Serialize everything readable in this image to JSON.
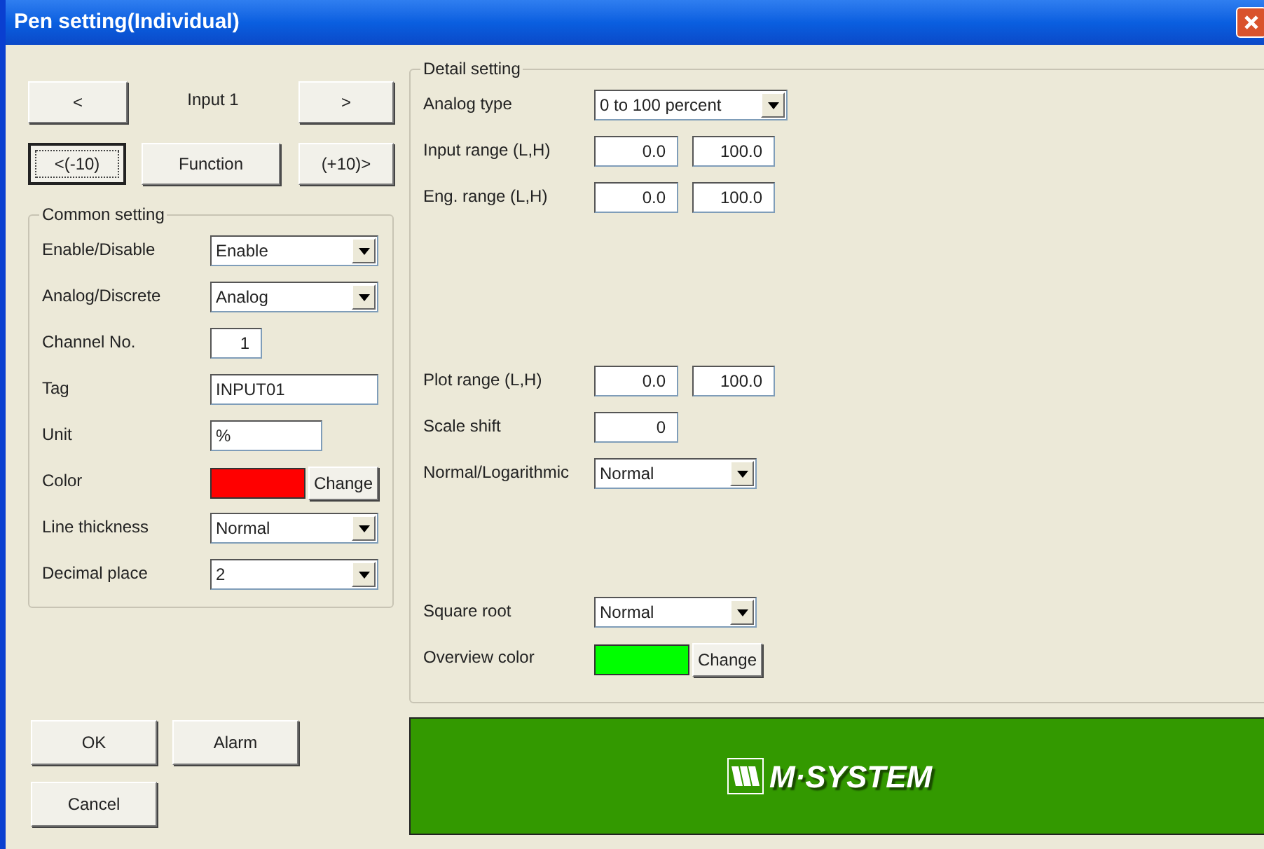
{
  "window": {
    "title": "Pen setting(Individual)"
  },
  "navigation": {
    "previous": "<",
    "channel_label": "Input 1",
    "next": ">",
    "back_ten": "<(-10)",
    "function": "Function",
    "forward_ten": "(+10)>"
  },
  "common_setting": {
    "title": "Common setting",
    "rows": [
      {
        "kind": "select",
        "label": "Enable/Disable",
        "value": "Enable"
      },
      {
        "kind": "select",
        "label": "Analog/Discrete",
        "value": "Analog"
      },
      {
        "kind": "number",
        "label": "Channel No.",
        "value": "1"
      },
      {
        "kind": "text",
        "label": "Tag",
        "value": "INPUT01"
      },
      {
        "kind": "short_text",
        "label": "Unit",
        "value": "%"
      },
      {
        "kind": "color",
        "label": "Color",
        "color": "#ff0000",
        "button": "Change"
      },
      {
        "kind": "select",
        "label": "Line thickness",
        "value": "Normal"
      },
      {
        "kind": "select",
        "label": "Decimal place",
        "value": "2"
      }
    ]
  },
  "detail_setting": {
    "title": "Detail setting",
    "rows": [
      {
        "kind": "wide_select",
        "label": "Analog type",
        "value": "0 to 100 percent"
      },
      {
        "kind": "pair",
        "label": "Input range (L,H)",
        "low": "0.0",
        "high": "100.0"
      },
      {
        "kind": "pair",
        "label": "Eng. range (L,H)",
        "low": "0.0",
        "high": "100.0"
      },
      {
        "kind": "pair",
        "label": "Plot range (L,H)",
        "low": "0.0",
        "high": "100.0"
      },
      {
        "kind": "number",
        "label": "Scale shift",
        "value": "0"
      },
      {
        "kind": "select",
        "label": "Normal/Logarithmic",
        "value": "Normal"
      },
      {
        "kind": "select",
        "label": "Square root",
        "value": "Normal"
      },
      {
        "kind": "color",
        "label": "Overview color",
        "color": "#00ff00",
        "button": "Change"
      }
    ]
  },
  "buttons": {
    "ok": "OK",
    "alarm": "Alarm",
    "cancel": "Cancel"
  },
  "banner": {
    "logo_text": "M·SYSTEM"
  }
}
